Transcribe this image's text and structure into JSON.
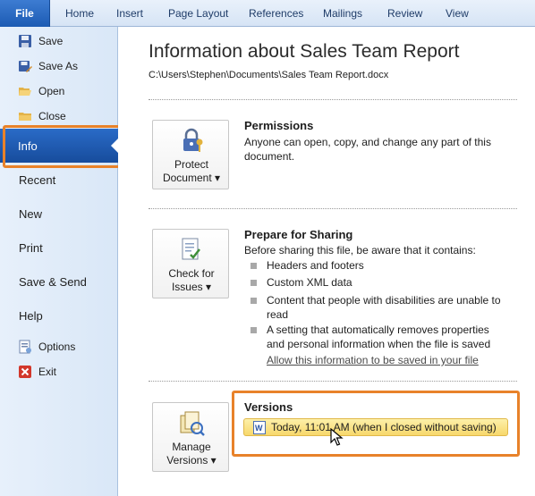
{
  "ribbon": {
    "file_tab": "File",
    "tabs": [
      "Home",
      "Insert",
      "Page Layout",
      "References",
      "Mailings",
      "Review",
      "View"
    ]
  },
  "nav": {
    "small_top": [
      {
        "label": "Save",
        "icon": "save-icon"
      },
      {
        "label": "Save As",
        "icon": "save-as-icon"
      },
      {
        "label": "Open",
        "icon": "open-folder-icon"
      },
      {
        "label": "Close",
        "icon": "close-folder-icon"
      }
    ],
    "selected": "Info",
    "big": [
      "Recent",
      "New",
      "Print",
      "Save & Send",
      "Help"
    ],
    "small_bottom": [
      {
        "label": "Options",
        "icon": "options-icon"
      },
      {
        "label": "Exit",
        "icon": "exit-icon"
      }
    ]
  },
  "info": {
    "title": "Information about Sales Team Report",
    "path": "C:\\Users\\Stephen\\Documents\\Sales Team Report.docx"
  },
  "permissions": {
    "button_line1": "Protect",
    "button_line2": "Document ▾",
    "heading": "Permissions",
    "text": "Anyone can open, copy, and change any part of this document."
  },
  "sharing": {
    "button_line1": "Check for",
    "button_line2": "Issues ▾",
    "heading": "Prepare for Sharing",
    "intro": "Before sharing this file, be aware that it contains:",
    "items": [
      "Headers and footers",
      "Custom XML data",
      "Content that people with disabilities are unable to read",
      "A setting that automatically removes properties and personal information when the file is saved"
    ],
    "link": "Allow this information to be saved in your file"
  },
  "versions": {
    "button_line1": "Manage",
    "button_line2": "Versions ▾",
    "heading": "Versions",
    "entry": "Today, 11:01 AM (when I closed without saving)"
  },
  "colors": {
    "accent_highlight": "#e8822a",
    "file_tab": "#1c5bb3",
    "selected_nav": "#174c9c",
    "version_pill": "#f7d86b"
  }
}
